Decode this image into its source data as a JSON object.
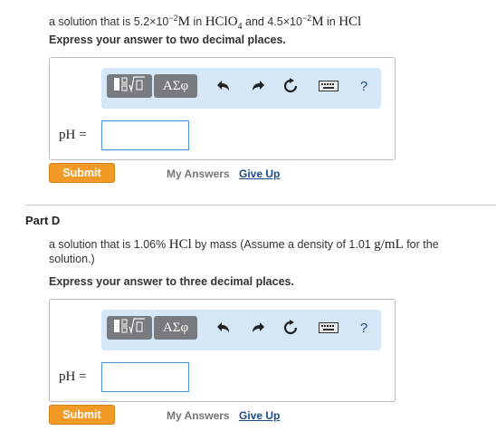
{
  "part_c": {
    "problem": {
      "prefix": "a solution that is 5.2×10",
      "exp1": "−2",
      "unit1": "M",
      "in1": " in ",
      "acid1": "HClO",
      "sub1": "4",
      "mid": " and 4.5×10",
      "exp2": "−2",
      "unit2": "M",
      "in2": " in ",
      "acid2": "HCl"
    },
    "instruction": "Express your answer to two decimal places.",
    "answer_label": "pH =",
    "answer_value": ""
  },
  "part_d": {
    "heading": "Part D",
    "problem": {
      "prefix": "a solution that is 1.06% ",
      "acid": "HCl",
      "mid": " by mass (Assume a density of 1.01 ",
      "density_unit": "g/mL",
      "suffix": " for the",
      "line2": "solution.)"
    },
    "instruction": "Express your answer to three decimal places.",
    "answer_label": "pH =",
    "answer_value": ""
  },
  "toolbar": {
    "templates_icon": "fraction-sqrt-template-icon",
    "symbols_label": "ΑΣφ",
    "undo_icon": "undo-icon",
    "redo_icon": "redo-icon",
    "reset_icon": "reset-icon",
    "keyboard_icon": "keyboard-icon",
    "help_label": "?"
  },
  "actions": {
    "submit_label": "Submit",
    "my_answers_label": "My Answers",
    "give_up_label": "Give Up"
  },
  "colors": {
    "submit": "#f19a25",
    "toolbar_bg": "#d5e6f7",
    "toolbar_button": "#777a7e",
    "link": "#1a4c8a",
    "input_border": "#4a90d9"
  }
}
